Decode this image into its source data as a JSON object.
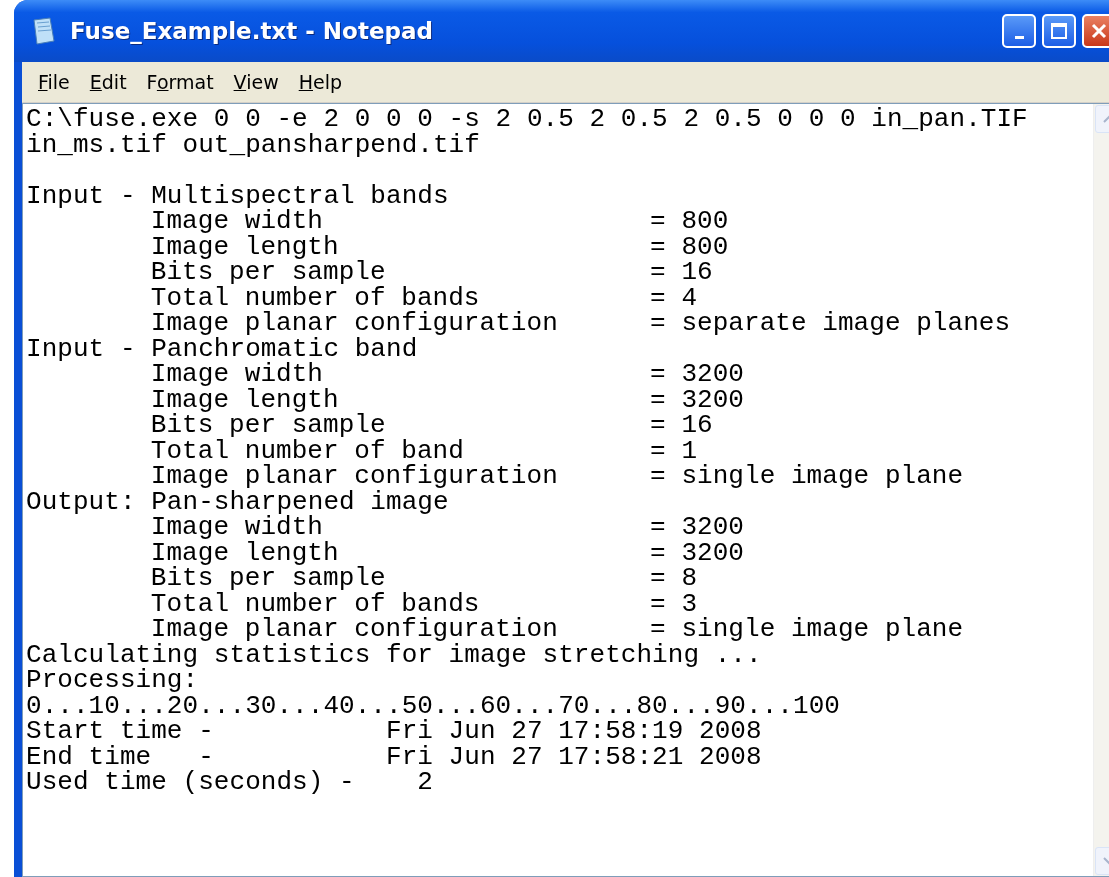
{
  "window": {
    "title": "Fuse_Example.txt - Notepad"
  },
  "menu": [
    {
      "label": "File"
    },
    {
      "label": "Edit"
    },
    {
      "label": "Format"
    },
    {
      "label": "View"
    },
    {
      "label": "Help"
    }
  ],
  "document": {
    "command_lines": [
      "C:\\fuse.exe 0 0 -e 2 0 0 0 -s 2 0.5 2 0.5 2 0.5 0 0 0 in_pan.TIF",
      "in_ms.tif out_pansharpend.tif"
    ],
    "sections": [
      {
        "heading": "Input - Multispectral bands",
        "fields": [
          {
            "label": "Image width",
            "value": "= 800"
          },
          {
            "label": "Image length",
            "value": "= 800"
          },
          {
            "label": "Bits per sample",
            "value": "= 16"
          },
          {
            "label": "Total number of bands",
            "value": "= 4"
          },
          {
            "label": "Image planar configuration",
            "value": "= separate image planes"
          }
        ]
      },
      {
        "heading": "Input - Panchromatic band",
        "fields": [
          {
            "label": "Image width",
            "value": "= 3200"
          },
          {
            "label": "Image length",
            "value": "= 3200"
          },
          {
            "label": "Bits per sample",
            "value": "= 16"
          },
          {
            "label": "Total number of band",
            "value": "= 1"
          },
          {
            "label": "Image planar configuration",
            "value": "= single image plane"
          }
        ]
      },
      {
        "heading": "Output: Pan-sharpened image",
        "fields": [
          {
            "label": "Image width",
            "value": "= 3200"
          },
          {
            "label": "Image length",
            "value": "= 3200"
          },
          {
            "label": "Bits per sample",
            "value": "= 8"
          },
          {
            "label": "Total number of bands",
            "value": "= 3"
          },
          {
            "label": "Image planar configuration",
            "value": "= single image plane"
          }
        ]
      }
    ],
    "trailing_lines": [
      "Calculating statistics for image stretching ...",
      "Processing:",
      "0...10...20...30...40...50...60...70...80...90...100",
      "Start time -           Fri Jun 27 17:58:19 2008",
      "End time   -           Fri Jun 27 17:58:21 2008",
      "Used time (seconds) -    2"
    ]
  }
}
